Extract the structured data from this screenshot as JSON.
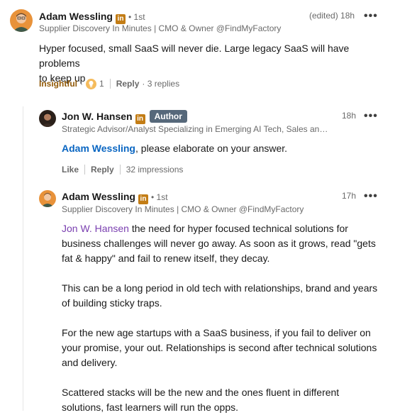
{
  "comment1": {
    "author_name": "Adam Wessling",
    "linkedin_badge": "in",
    "degree": "• 1st",
    "edited_time": "(edited) 18h",
    "headline": "Supplier Discovery In Minutes | CMO & Owner @FindMyFactory",
    "body_line1": "Hyper focused, small SaaS will never die. Large legacy SaaS will have problems",
    "body_line2": "to keep up",
    "insightful_label": "Insightful",
    "dot": "·",
    "reaction_count": "1",
    "reply_label": "Reply",
    "replies_count": "· 3 replies",
    "more_label": "•••",
    "accent_color": "#915907"
  },
  "reply1": {
    "author_name": "Jon W. Hansen",
    "linkedin_badge": "in",
    "author_badge": "Author",
    "time": "18h",
    "headline": "Strategic Advisor/Analyst Specializing in Emerging AI Tech, Sales and ...",
    "mention": "Adam Wessling",
    "body_rest": ", please elaborate on your answer.",
    "like_label": "Like",
    "reply_label": "Reply",
    "impressions": "32 impressions",
    "more_label": "•••",
    "mention_color": "#0a66c2"
  },
  "reply2": {
    "author_name": "Adam Wessling",
    "linkedin_badge": "in",
    "degree": "• 1st",
    "time": "17h",
    "headline": "Supplier Discovery In Minutes | CMO & Owner @FindMyFactory",
    "mention": "Jon W. Hansen",
    "p1_line1_rest": " the need for hyper focused technical solutions for",
    "p1_line2": "business challenges will never go away. As soon as it grows, read \"gets",
    "p1_line3": "fat & happy\" and fail to renew itself, they decay.",
    "p2_line1": "This can be a long period in old tech with relationships, brand and years",
    "p2_line2": "of building sticky traps.",
    "p3_line1": "For the new age startups with a SaaS business, if you fail to deliver on",
    "p3_line2": "your promise, your out. Relationships is second after technical solutions",
    "p3_line3": "and delivery.",
    "p4_line1": "Scattered stacks will be the new and the ones fluent in different",
    "p4_line2": "solutions, fast learners will run the opps.",
    "more_label": "•••",
    "mention_color": "#7a3fb0"
  }
}
